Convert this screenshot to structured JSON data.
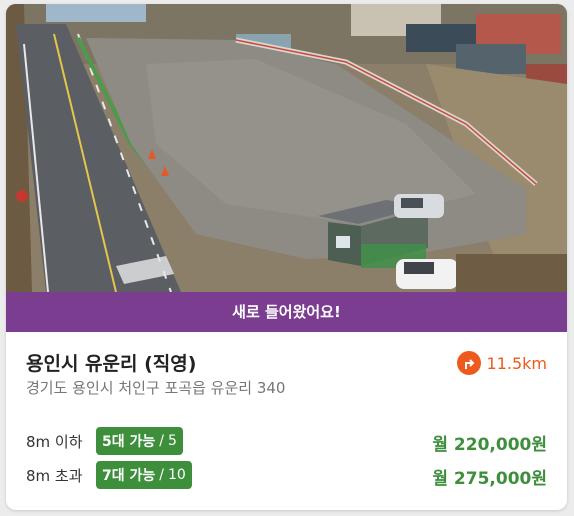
{
  "banner": {
    "text": "새로 들어왔어요!"
  },
  "listing": {
    "title": "용인시 유운리 (직영)",
    "address": "경기도 용인시 처인구 포곡읍 유운리 340",
    "distance": "11.5km",
    "direction_icon": "turn-right-icon"
  },
  "rates": [
    {
      "label": "8m 이하",
      "availability": "5대 가능",
      "capacity": "5",
      "price": "월 220,000원"
    },
    {
      "label": "8m 초과",
      "availability": "7대 가능",
      "capacity": "10",
      "price": "월 275,000원"
    }
  ],
  "colors": {
    "accent": "#ee5a1d",
    "banner": "#7a3d8f",
    "green": "#3d8f3c"
  }
}
